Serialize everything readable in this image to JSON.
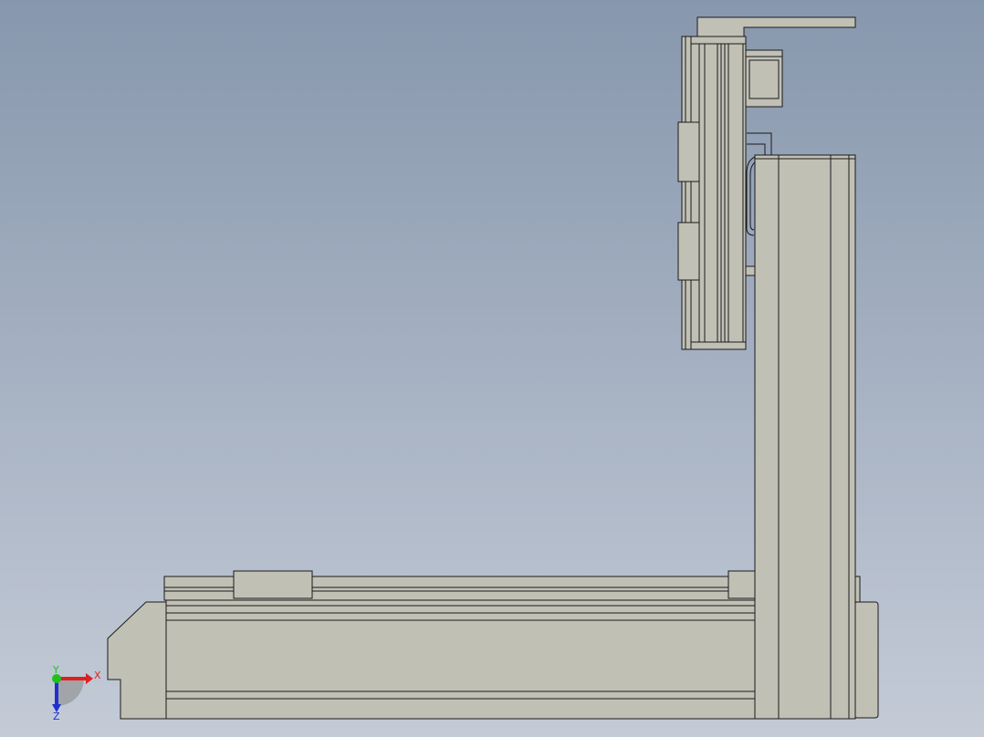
{
  "viewport": {
    "background_top": "#8797ad",
    "background_bottom": "#c4cbd7",
    "part_fill": "#c1c0b5",
    "edge_color": "#1a1a1a"
  },
  "triad": {
    "x_label": "X",
    "y_label": "Y",
    "z_label": "Z",
    "x_color": "#e02020",
    "y_color": "#20c020",
    "z_color": "#2030d0"
  }
}
